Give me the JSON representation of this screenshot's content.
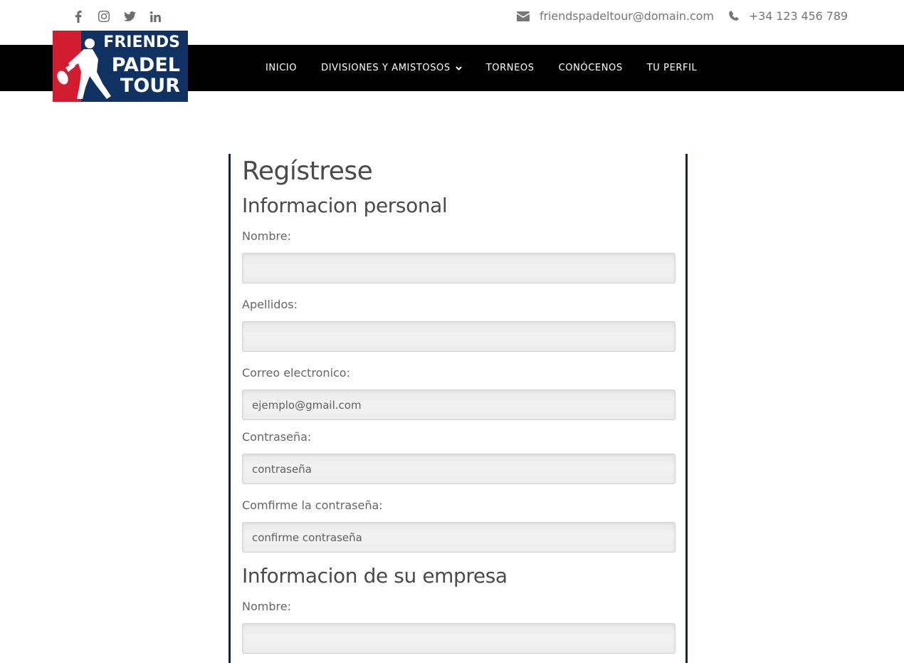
{
  "social": {
    "icons": [
      "facebook-icon",
      "instagram-icon",
      "twitter-icon",
      "linkedin-icon"
    ]
  },
  "contact": {
    "email": "friendspadeltour@domain.com",
    "phone": "+34 123 456 789"
  },
  "logo": {
    "line1": "FRIENDS",
    "line2": "PADEL",
    "line3": "TOUR",
    "colors": {
      "blue": "#0f3262",
      "red": "#d31c30"
    }
  },
  "nav": {
    "items": [
      {
        "label": "INICIO"
      },
      {
        "label": "DIVISIONES Y AMISTOSOS"
      },
      {
        "label": "TORNEOS"
      },
      {
        "label": "CONÓCENOS"
      },
      {
        "label": "TU PERFIL"
      }
    ]
  },
  "form": {
    "title": "Regístrese",
    "personal_heading": "Informacion personal",
    "fields": {
      "nombre": {
        "label": "Nombre:",
        "placeholder": ""
      },
      "apellidos": {
        "label": "Apellidos:",
        "placeholder": ""
      },
      "email": {
        "label": "Correo electronico:",
        "placeholder": "ejemplo@gmail.com"
      },
      "password": {
        "label": "Contraseña:",
        "placeholder": "contraseña"
      },
      "confirm": {
        "label": "Comfirme la contraseña:",
        "placeholder": "confirme contraseña"
      }
    },
    "company_heading": "Informacion de su empresa",
    "company_fields": {
      "nombre": {
        "label": "Nombre:",
        "placeholder": ""
      }
    }
  },
  "colors": {
    "accent": "#0d2a47",
    "navbar": "#000000"
  }
}
